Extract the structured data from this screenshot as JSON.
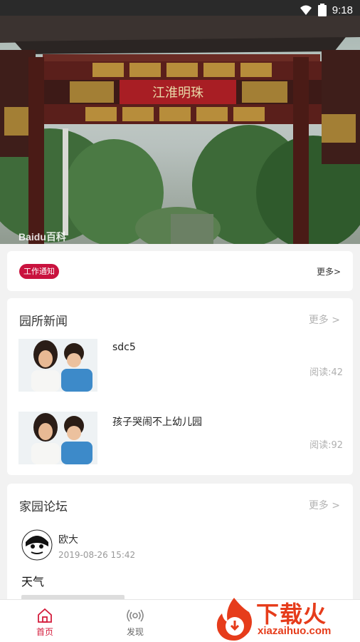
{
  "status_bar": {
    "time": "9:18"
  },
  "banner": {
    "gate_plaque": "江淮明珠",
    "watermark": "Baidu百科"
  },
  "notice": {
    "badge": "工作通知",
    "more": "更多>"
  },
  "news": {
    "title": "园所新闻",
    "more": "更多 >",
    "items": [
      {
        "title": "sdc5",
        "reads": "阅读:42"
      },
      {
        "title": "孩子哭闹不上幼儿园",
        "reads": "阅读:92"
      }
    ]
  },
  "forum": {
    "title": "家园论坛",
    "more": "更多 >",
    "post": {
      "author": "欧大",
      "time": "2019-08-26 15:42",
      "title": "天气"
    }
  },
  "tabbar": {
    "tabs": [
      {
        "label": "首页",
        "icon": "home-icon",
        "active": true
      },
      {
        "label": "发现",
        "icon": "broadcast-icon",
        "active": false
      }
    ],
    "active_color": "#d41d3c",
    "inactive_color": "#666666"
  },
  "watermark_logo": {
    "text": "下载火",
    "url": "xiazaihuo.com"
  }
}
